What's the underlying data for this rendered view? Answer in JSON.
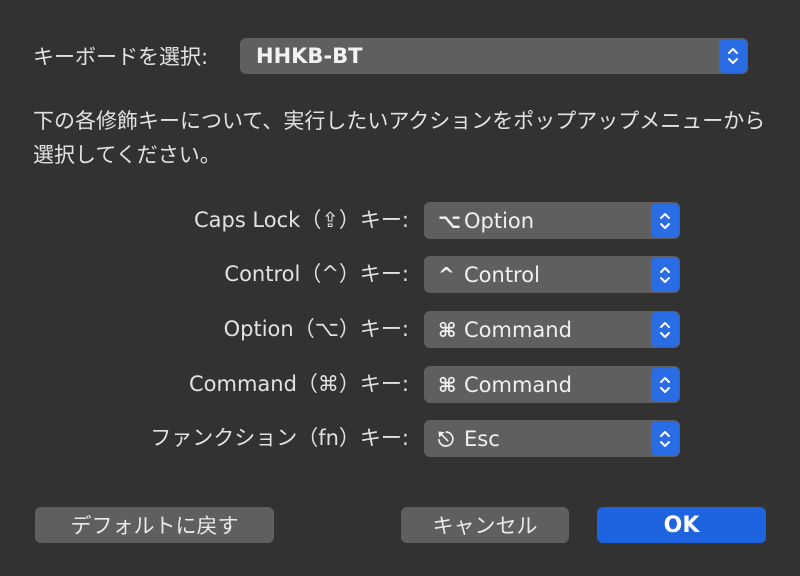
{
  "keyboard": {
    "label": "キーボードを選択:",
    "selected": "HHKB-BT"
  },
  "description": "下の各修飾キーについて、実行したいアクションをポップアップメニューから選択してください。",
  "modifiers": [
    {
      "label": "Caps Lock（⇪）キー:",
      "glyph": "⌥",
      "value": "Option"
    },
    {
      "label": "Control（^）キー:",
      "glyph": "^",
      "value": "Control"
    },
    {
      "label": "Option（⌥）キー:",
      "glyph": "⌘",
      "value": "Command"
    },
    {
      "label": "Command（⌘）キー:",
      "glyph": "⌘",
      "value": "Command"
    },
    {
      "label": "ファンクション（fn）キー:",
      "glyph": "⎋",
      "value": "Esc"
    }
  ],
  "buttons": {
    "restore_defaults": "デフォルトに戻す",
    "cancel": "キャンセル",
    "ok": "OK"
  },
  "colors": {
    "background": "#323233",
    "control": "#5f5f5f",
    "accent": "#1e63e0"
  }
}
